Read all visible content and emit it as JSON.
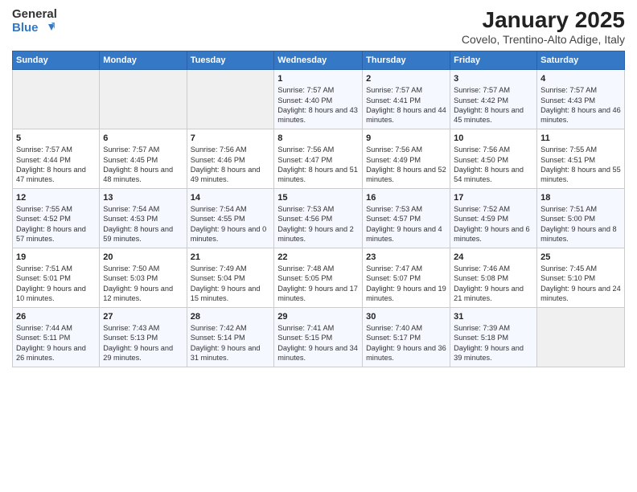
{
  "header": {
    "title": "January 2025",
    "subtitle": "Covelo, Trentino-Alto Adige, Italy"
  },
  "days_of_week": [
    "Sunday",
    "Monday",
    "Tuesday",
    "Wednesday",
    "Thursday",
    "Friday",
    "Saturday"
  ],
  "weeks": [
    [
      {
        "num": "",
        "info": ""
      },
      {
        "num": "",
        "info": ""
      },
      {
        "num": "",
        "info": ""
      },
      {
        "num": "1",
        "info": "Sunrise: 7:57 AM\nSunset: 4:40 PM\nDaylight: 8 hours and 43 minutes."
      },
      {
        "num": "2",
        "info": "Sunrise: 7:57 AM\nSunset: 4:41 PM\nDaylight: 8 hours and 44 minutes."
      },
      {
        "num": "3",
        "info": "Sunrise: 7:57 AM\nSunset: 4:42 PM\nDaylight: 8 hours and 45 minutes."
      },
      {
        "num": "4",
        "info": "Sunrise: 7:57 AM\nSunset: 4:43 PM\nDaylight: 8 hours and 46 minutes."
      }
    ],
    [
      {
        "num": "5",
        "info": "Sunrise: 7:57 AM\nSunset: 4:44 PM\nDaylight: 8 hours and 47 minutes."
      },
      {
        "num": "6",
        "info": "Sunrise: 7:57 AM\nSunset: 4:45 PM\nDaylight: 8 hours and 48 minutes."
      },
      {
        "num": "7",
        "info": "Sunrise: 7:56 AM\nSunset: 4:46 PM\nDaylight: 8 hours and 49 minutes."
      },
      {
        "num": "8",
        "info": "Sunrise: 7:56 AM\nSunset: 4:47 PM\nDaylight: 8 hours and 51 minutes."
      },
      {
        "num": "9",
        "info": "Sunrise: 7:56 AM\nSunset: 4:49 PM\nDaylight: 8 hours and 52 minutes."
      },
      {
        "num": "10",
        "info": "Sunrise: 7:56 AM\nSunset: 4:50 PM\nDaylight: 8 hours and 54 minutes."
      },
      {
        "num": "11",
        "info": "Sunrise: 7:55 AM\nSunset: 4:51 PM\nDaylight: 8 hours and 55 minutes."
      }
    ],
    [
      {
        "num": "12",
        "info": "Sunrise: 7:55 AM\nSunset: 4:52 PM\nDaylight: 8 hours and 57 minutes."
      },
      {
        "num": "13",
        "info": "Sunrise: 7:54 AM\nSunset: 4:53 PM\nDaylight: 8 hours and 59 minutes."
      },
      {
        "num": "14",
        "info": "Sunrise: 7:54 AM\nSunset: 4:55 PM\nDaylight: 9 hours and 0 minutes."
      },
      {
        "num": "15",
        "info": "Sunrise: 7:53 AM\nSunset: 4:56 PM\nDaylight: 9 hours and 2 minutes."
      },
      {
        "num": "16",
        "info": "Sunrise: 7:53 AM\nSunset: 4:57 PM\nDaylight: 9 hours and 4 minutes."
      },
      {
        "num": "17",
        "info": "Sunrise: 7:52 AM\nSunset: 4:59 PM\nDaylight: 9 hours and 6 minutes."
      },
      {
        "num": "18",
        "info": "Sunrise: 7:51 AM\nSunset: 5:00 PM\nDaylight: 9 hours and 8 minutes."
      }
    ],
    [
      {
        "num": "19",
        "info": "Sunrise: 7:51 AM\nSunset: 5:01 PM\nDaylight: 9 hours and 10 minutes."
      },
      {
        "num": "20",
        "info": "Sunrise: 7:50 AM\nSunset: 5:03 PM\nDaylight: 9 hours and 12 minutes."
      },
      {
        "num": "21",
        "info": "Sunrise: 7:49 AM\nSunset: 5:04 PM\nDaylight: 9 hours and 15 minutes."
      },
      {
        "num": "22",
        "info": "Sunrise: 7:48 AM\nSunset: 5:05 PM\nDaylight: 9 hours and 17 minutes."
      },
      {
        "num": "23",
        "info": "Sunrise: 7:47 AM\nSunset: 5:07 PM\nDaylight: 9 hours and 19 minutes."
      },
      {
        "num": "24",
        "info": "Sunrise: 7:46 AM\nSunset: 5:08 PM\nDaylight: 9 hours and 21 minutes."
      },
      {
        "num": "25",
        "info": "Sunrise: 7:45 AM\nSunset: 5:10 PM\nDaylight: 9 hours and 24 minutes."
      }
    ],
    [
      {
        "num": "26",
        "info": "Sunrise: 7:44 AM\nSunset: 5:11 PM\nDaylight: 9 hours and 26 minutes."
      },
      {
        "num": "27",
        "info": "Sunrise: 7:43 AM\nSunset: 5:13 PM\nDaylight: 9 hours and 29 minutes."
      },
      {
        "num": "28",
        "info": "Sunrise: 7:42 AM\nSunset: 5:14 PM\nDaylight: 9 hours and 31 minutes."
      },
      {
        "num": "29",
        "info": "Sunrise: 7:41 AM\nSunset: 5:15 PM\nDaylight: 9 hours and 34 minutes."
      },
      {
        "num": "30",
        "info": "Sunrise: 7:40 AM\nSunset: 5:17 PM\nDaylight: 9 hours and 36 minutes."
      },
      {
        "num": "31",
        "info": "Sunrise: 7:39 AM\nSunset: 5:18 PM\nDaylight: 9 hours and 39 minutes."
      },
      {
        "num": "",
        "info": ""
      }
    ]
  ]
}
